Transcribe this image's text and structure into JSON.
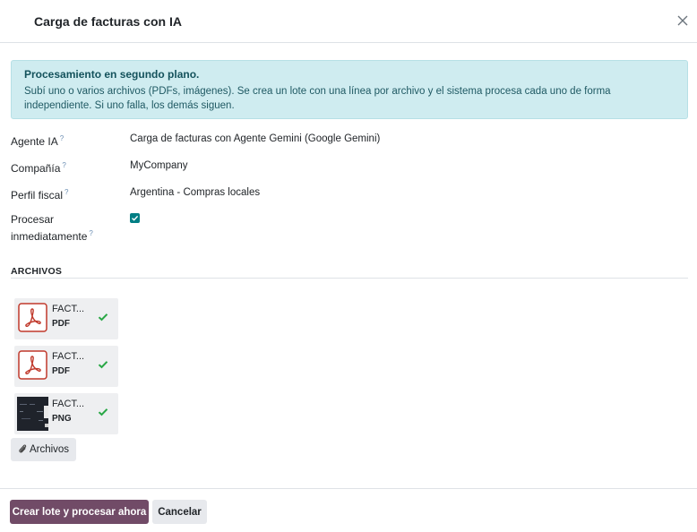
{
  "dialog": {
    "title": "Carga de facturas con IA"
  },
  "alert": {
    "title": "Procesamiento en segundo plano.",
    "text": "Subí uno o varios archivos (PDFs, imágenes). Se crea un lote con una línea por archivo y el sistema procesa cada uno de forma independiente. Si uno falla, los demás siguen."
  },
  "form": {
    "agent": {
      "label": "Agente IA",
      "help": "?",
      "value": "Carga de facturas con Agente Gemini (Google Gemini)"
    },
    "company": {
      "label": "Compañía",
      "help": "?",
      "value": "MyCompany"
    },
    "fiscal": {
      "label": "Perfil fiscal",
      "help": "?",
      "value": "Argentina - Compras locales"
    },
    "process": {
      "label_line1": "Procesar",
      "label_line2": "inmediatamente",
      "help": "?",
      "checked": true
    }
  },
  "files": {
    "section_title": "ARCHIVOS",
    "items": [
      {
        "name": "FACT...",
        "ext": "PDF",
        "icon": "pdf-icon",
        "status": "check-icon"
      },
      {
        "name": "FACT...",
        "ext": "PDF",
        "icon": "pdf-icon",
        "status": "check-icon"
      },
      {
        "name": "FACT...",
        "ext": "PNG",
        "icon": "image-thumbnail",
        "status": "check-icon"
      }
    ],
    "add_button": "Archivos"
  },
  "footer": {
    "primary": "Crear lote y procesar ahora",
    "cancel": "Cancelar"
  },
  "colors": {
    "primary": "#714b67",
    "alert_bg": "#cfecf0",
    "checkbox": "#017e84",
    "success": "#28a745",
    "pdf": "#c0392b"
  }
}
